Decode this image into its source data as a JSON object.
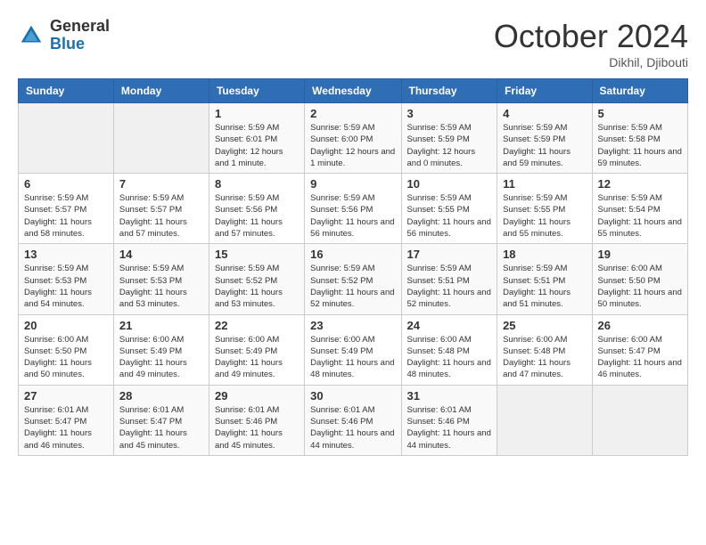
{
  "header": {
    "logo_general": "General",
    "logo_blue": "Blue",
    "month_title": "October 2024",
    "location": "Dikhil, Djibouti"
  },
  "days_of_week": [
    "Sunday",
    "Monday",
    "Tuesday",
    "Wednesday",
    "Thursday",
    "Friday",
    "Saturday"
  ],
  "weeks": [
    [
      {
        "day": "",
        "info": ""
      },
      {
        "day": "",
        "info": ""
      },
      {
        "day": "1",
        "info": "Sunrise: 5:59 AM\nSunset: 6:01 PM\nDaylight: 12 hours and 1 minute."
      },
      {
        "day": "2",
        "info": "Sunrise: 5:59 AM\nSunset: 6:00 PM\nDaylight: 12 hours and 1 minute."
      },
      {
        "day": "3",
        "info": "Sunrise: 5:59 AM\nSunset: 5:59 PM\nDaylight: 12 hours and 0 minutes."
      },
      {
        "day": "4",
        "info": "Sunrise: 5:59 AM\nSunset: 5:59 PM\nDaylight: 11 hours and 59 minutes."
      },
      {
        "day": "5",
        "info": "Sunrise: 5:59 AM\nSunset: 5:58 PM\nDaylight: 11 hours and 59 minutes."
      }
    ],
    [
      {
        "day": "6",
        "info": "Sunrise: 5:59 AM\nSunset: 5:57 PM\nDaylight: 11 hours and 58 minutes."
      },
      {
        "day": "7",
        "info": "Sunrise: 5:59 AM\nSunset: 5:57 PM\nDaylight: 11 hours and 57 minutes."
      },
      {
        "day": "8",
        "info": "Sunrise: 5:59 AM\nSunset: 5:56 PM\nDaylight: 11 hours and 57 minutes."
      },
      {
        "day": "9",
        "info": "Sunrise: 5:59 AM\nSunset: 5:56 PM\nDaylight: 11 hours and 56 minutes."
      },
      {
        "day": "10",
        "info": "Sunrise: 5:59 AM\nSunset: 5:55 PM\nDaylight: 11 hours and 56 minutes."
      },
      {
        "day": "11",
        "info": "Sunrise: 5:59 AM\nSunset: 5:55 PM\nDaylight: 11 hours and 55 minutes."
      },
      {
        "day": "12",
        "info": "Sunrise: 5:59 AM\nSunset: 5:54 PM\nDaylight: 11 hours and 55 minutes."
      }
    ],
    [
      {
        "day": "13",
        "info": "Sunrise: 5:59 AM\nSunset: 5:53 PM\nDaylight: 11 hours and 54 minutes."
      },
      {
        "day": "14",
        "info": "Sunrise: 5:59 AM\nSunset: 5:53 PM\nDaylight: 11 hours and 53 minutes."
      },
      {
        "day": "15",
        "info": "Sunrise: 5:59 AM\nSunset: 5:52 PM\nDaylight: 11 hours and 53 minutes."
      },
      {
        "day": "16",
        "info": "Sunrise: 5:59 AM\nSunset: 5:52 PM\nDaylight: 11 hours and 52 minutes."
      },
      {
        "day": "17",
        "info": "Sunrise: 5:59 AM\nSunset: 5:51 PM\nDaylight: 11 hours and 52 minutes."
      },
      {
        "day": "18",
        "info": "Sunrise: 5:59 AM\nSunset: 5:51 PM\nDaylight: 11 hours and 51 minutes."
      },
      {
        "day": "19",
        "info": "Sunrise: 6:00 AM\nSunset: 5:50 PM\nDaylight: 11 hours and 50 minutes."
      }
    ],
    [
      {
        "day": "20",
        "info": "Sunrise: 6:00 AM\nSunset: 5:50 PM\nDaylight: 11 hours and 50 minutes."
      },
      {
        "day": "21",
        "info": "Sunrise: 6:00 AM\nSunset: 5:49 PM\nDaylight: 11 hours and 49 minutes."
      },
      {
        "day": "22",
        "info": "Sunrise: 6:00 AM\nSunset: 5:49 PM\nDaylight: 11 hours and 49 minutes."
      },
      {
        "day": "23",
        "info": "Sunrise: 6:00 AM\nSunset: 5:49 PM\nDaylight: 11 hours and 48 minutes."
      },
      {
        "day": "24",
        "info": "Sunrise: 6:00 AM\nSunset: 5:48 PM\nDaylight: 11 hours and 48 minutes."
      },
      {
        "day": "25",
        "info": "Sunrise: 6:00 AM\nSunset: 5:48 PM\nDaylight: 11 hours and 47 minutes."
      },
      {
        "day": "26",
        "info": "Sunrise: 6:00 AM\nSunset: 5:47 PM\nDaylight: 11 hours and 46 minutes."
      }
    ],
    [
      {
        "day": "27",
        "info": "Sunrise: 6:01 AM\nSunset: 5:47 PM\nDaylight: 11 hours and 46 minutes."
      },
      {
        "day": "28",
        "info": "Sunrise: 6:01 AM\nSunset: 5:47 PM\nDaylight: 11 hours and 45 minutes."
      },
      {
        "day": "29",
        "info": "Sunrise: 6:01 AM\nSunset: 5:46 PM\nDaylight: 11 hours and 45 minutes."
      },
      {
        "day": "30",
        "info": "Sunrise: 6:01 AM\nSunset: 5:46 PM\nDaylight: 11 hours and 44 minutes."
      },
      {
        "day": "31",
        "info": "Sunrise: 6:01 AM\nSunset: 5:46 PM\nDaylight: 11 hours and 44 minutes."
      },
      {
        "day": "",
        "info": ""
      },
      {
        "day": "",
        "info": ""
      }
    ]
  ]
}
